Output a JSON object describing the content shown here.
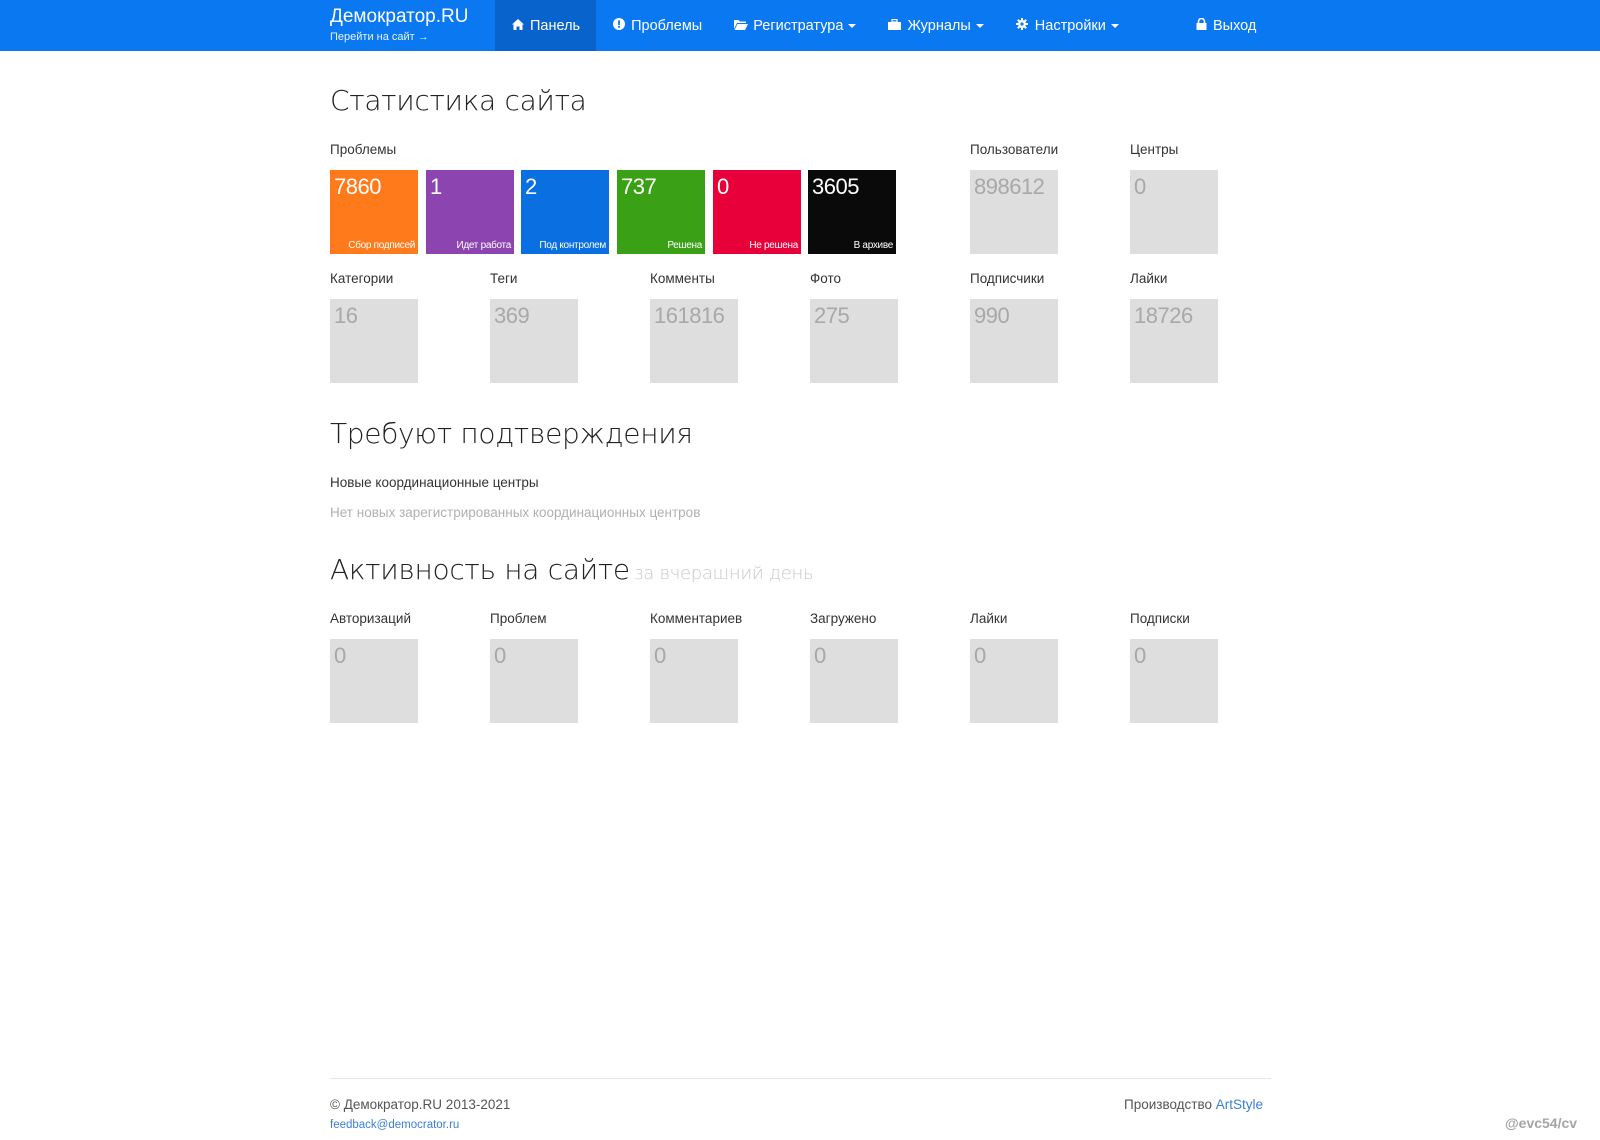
{
  "navbar": {
    "brand_title": "Демократор.RU",
    "brand_sub": "Перейти на сайт",
    "brand_sub_arrow": "→",
    "items": [
      {
        "label": "Панель",
        "icon": "home-icon",
        "active": true
      },
      {
        "label": "Проблемы",
        "icon": "exclamation-icon"
      },
      {
        "label": "Регистратура",
        "icon": "folder-icon",
        "dropdown": true
      },
      {
        "label": "Журналы",
        "icon": "briefcase-icon",
        "dropdown": true
      },
      {
        "label": "Настройки",
        "icon": "gear-icon",
        "dropdown": true
      }
    ],
    "logout": {
      "label": "Выход",
      "icon": "lock-icon"
    }
  },
  "colors": {
    "navbar": "#0a78f0",
    "navbar_active": "#0864cc",
    "tile_gray": "#dedede",
    "collecting": "#ff7a1a",
    "in_progress": "#8b44b0",
    "under_control": "#0a6fe0",
    "solved": "#3aa116",
    "not_solved": "#e8003a",
    "archived": "#0a0a0a"
  },
  "stats": {
    "title": "Статистика сайта",
    "problems_label": "Проблемы",
    "problems": [
      {
        "value": "7860",
        "label": "Сбор подписей"
      },
      {
        "value": "1",
        "label": "Идет работа"
      },
      {
        "value": "2",
        "label": "Под контролем"
      },
      {
        "value": "737",
        "label": "Решена"
      },
      {
        "value": "0",
        "label": "Не решена"
      },
      {
        "value": "3605",
        "label": "В архиве"
      }
    ],
    "users": {
      "label": "Пользователи",
      "value": "898612"
    },
    "centers": {
      "label": "Центры",
      "value": "0"
    },
    "row2": [
      {
        "label": "Категории",
        "value": "16"
      },
      {
        "label": "Теги",
        "value": "369"
      },
      {
        "label": "Комменты",
        "value": "161816"
      },
      {
        "label": "Фото",
        "value": "275"
      },
      {
        "label": "Подписчики",
        "value": "990"
      },
      {
        "label": "Лайки",
        "value": "18726"
      }
    ]
  },
  "confirm": {
    "title": "Требуют подтверждения",
    "subhead": "Новые координационные центры",
    "empty": "Нет новых зарегистрированных координационных центров"
  },
  "activity": {
    "title": "Активность на сайте",
    "subtitle": "за вчерашний день",
    "items": [
      {
        "label": "Авторизаций",
        "value": "0"
      },
      {
        "label": "Проблем",
        "value": "0"
      },
      {
        "label": "Комментариев",
        "value": "0"
      },
      {
        "label": "Загружено",
        "value": "0"
      },
      {
        "label": "Лайки",
        "value": "0"
      },
      {
        "label": "Подписки",
        "value": "0"
      }
    ]
  },
  "footer": {
    "copyright": "© Демократор.RU 2013-2021",
    "email": "feedback@democrator.ru",
    "made_by": "Производство",
    "made_by_link": "ArtStyle"
  },
  "watermark": "@evc54/cv"
}
